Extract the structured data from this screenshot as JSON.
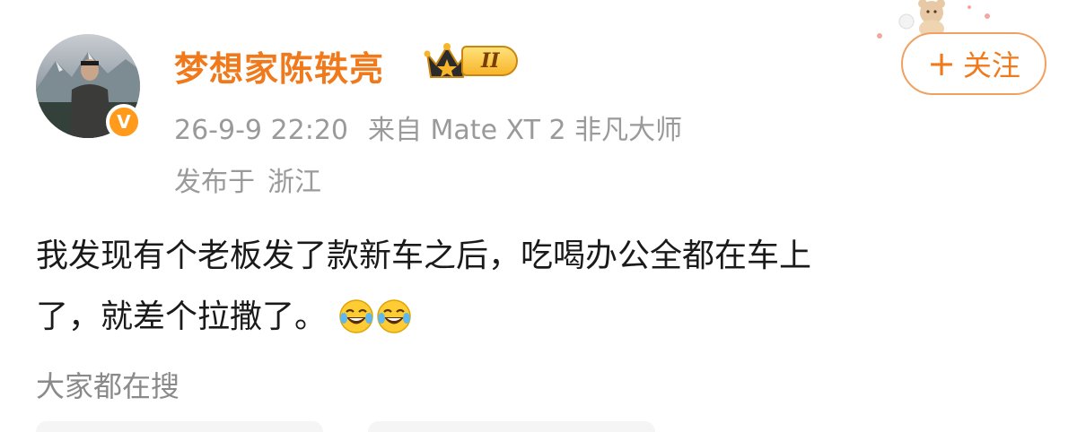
{
  "post": {
    "author": {
      "name": "梦想家陈轶亮",
      "verified_badge": "V",
      "vip_level": "II"
    },
    "follow_button": {
      "icon": "+",
      "label": "关注"
    },
    "meta": {
      "time": "26-9-9 22:20",
      "source": "来自 Mate XT 2 非凡大师",
      "location_prefix": "发布于",
      "location": "浙江"
    },
    "content": {
      "text_line1": "我发现有个老板发了款新车之后，吃喝办公全都在车上",
      "text_line2": "了，就差个拉撒了。",
      "emojis": [
        "laugh-cry-emoji",
        "laugh-cry-emoji"
      ]
    },
    "trending_label": "大家都在搜"
  },
  "colors": {
    "accent": "#f07a1b",
    "meta_text": "#9a9a9a",
    "body_text": "#1a1a1a",
    "badge": "#ff9a1a"
  }
}
